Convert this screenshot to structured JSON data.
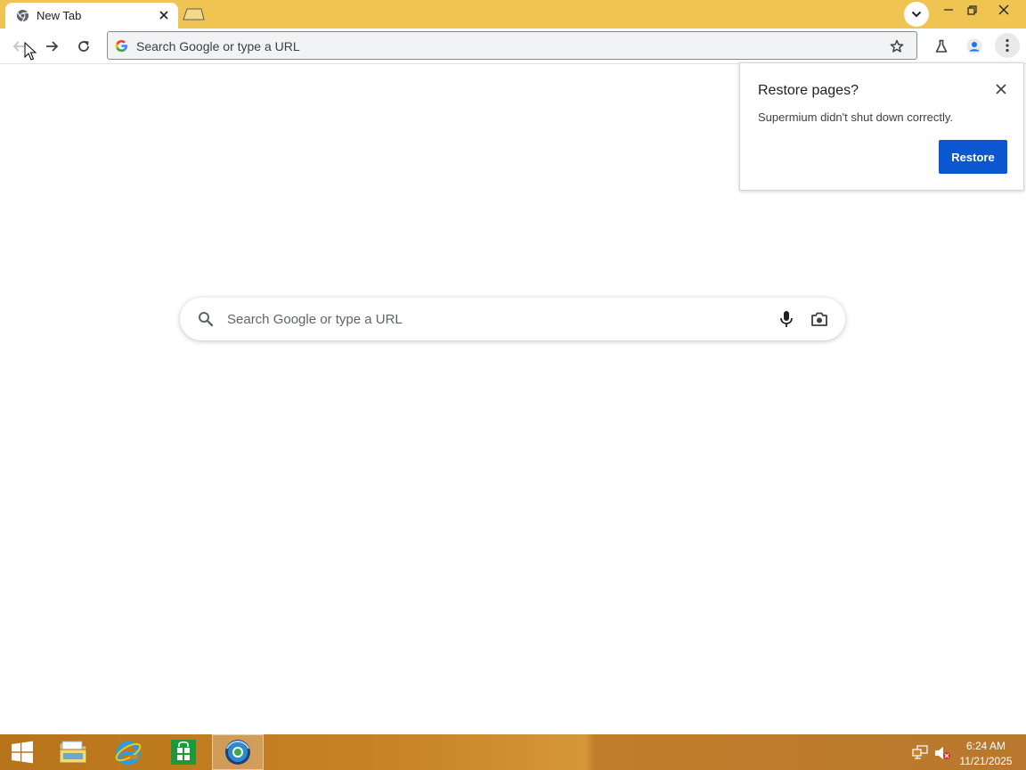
{
  "browser": {
    "tab": {
      "title": "New Tab"
    },
    "omnibox": {
      "placeholder": "Search Google or type a URL"
    }
  },
  "popup": {
    "title": "Restore pages?",
    "message": "Supermium didn't shut down correctly.",
    "restore_label": "Restore"
  },
  "ntp": {
    "search_placeholder": "Search Google or type a URL"
  },
  "taskbar": {
    "clock_time": "6:24 AM",
    "clock_date": "11/21/2025"
  },
  "icons": {
    "tab_favicon": "chromium-icon",
    "omnibox": "google-g-icon",
    "star": "star-icon",
    "labs": "flask-icon",
    "profile": "person-icon",
    "menu": "kebab-menu-icon",
    "mic": "microphone-icon",
    "camera": "camera-icon"
  },
  "colors": {
    "titlebar": "#f0c452",
    "restore_button": "#0b57d0",
    "taskbar": "#c98428"
  }
}
